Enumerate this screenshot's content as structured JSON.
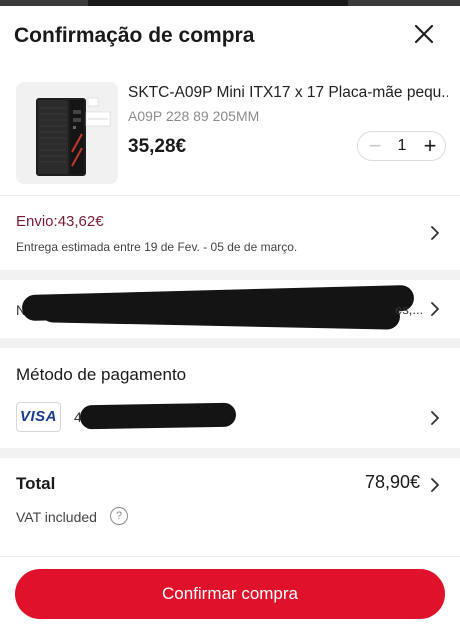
{
  "header": {
    "title": "Confirmação de compra",
    "close_icon": "close-icon"
  },
  "product": {
    "name": "SKTC-A09P Mini ITX17 x 17 Placa-mãe pequ...",
    "variant": "A09P 228 89 205MM",
    "price": "35,28€",
    "quantity": "1",
    "decrement_icon": "minus-icon",
    "increment_icon": "plus-icon"
  },
  "shipping": {
    "cost": "Envio:43,62€",
    "estimate": "Entrega estimada entre 19 de Fev. - 05 de de março."
  },
  "address": {
    "visible_prefix": "N",
    "visible_suffix": "es,..."
  },
  "payment": {
    "title": "Método de pagamento",
    "card_brand": "VISA",
    "card_prefix": "4"
  },
  "total": {
    "label": "Total",
    "value": "78,90€",
    "vat_label": "VAT included",
    "help_symbol": "?"
  },
  "actions": {
    "confirm_label": "Confirmar compra"
  },
  "colors": {
    "accent": "#e0112b",
    "shipping_text": "#7a1b36",
    "visa_blue": "#1a3c8f"
  }
}
